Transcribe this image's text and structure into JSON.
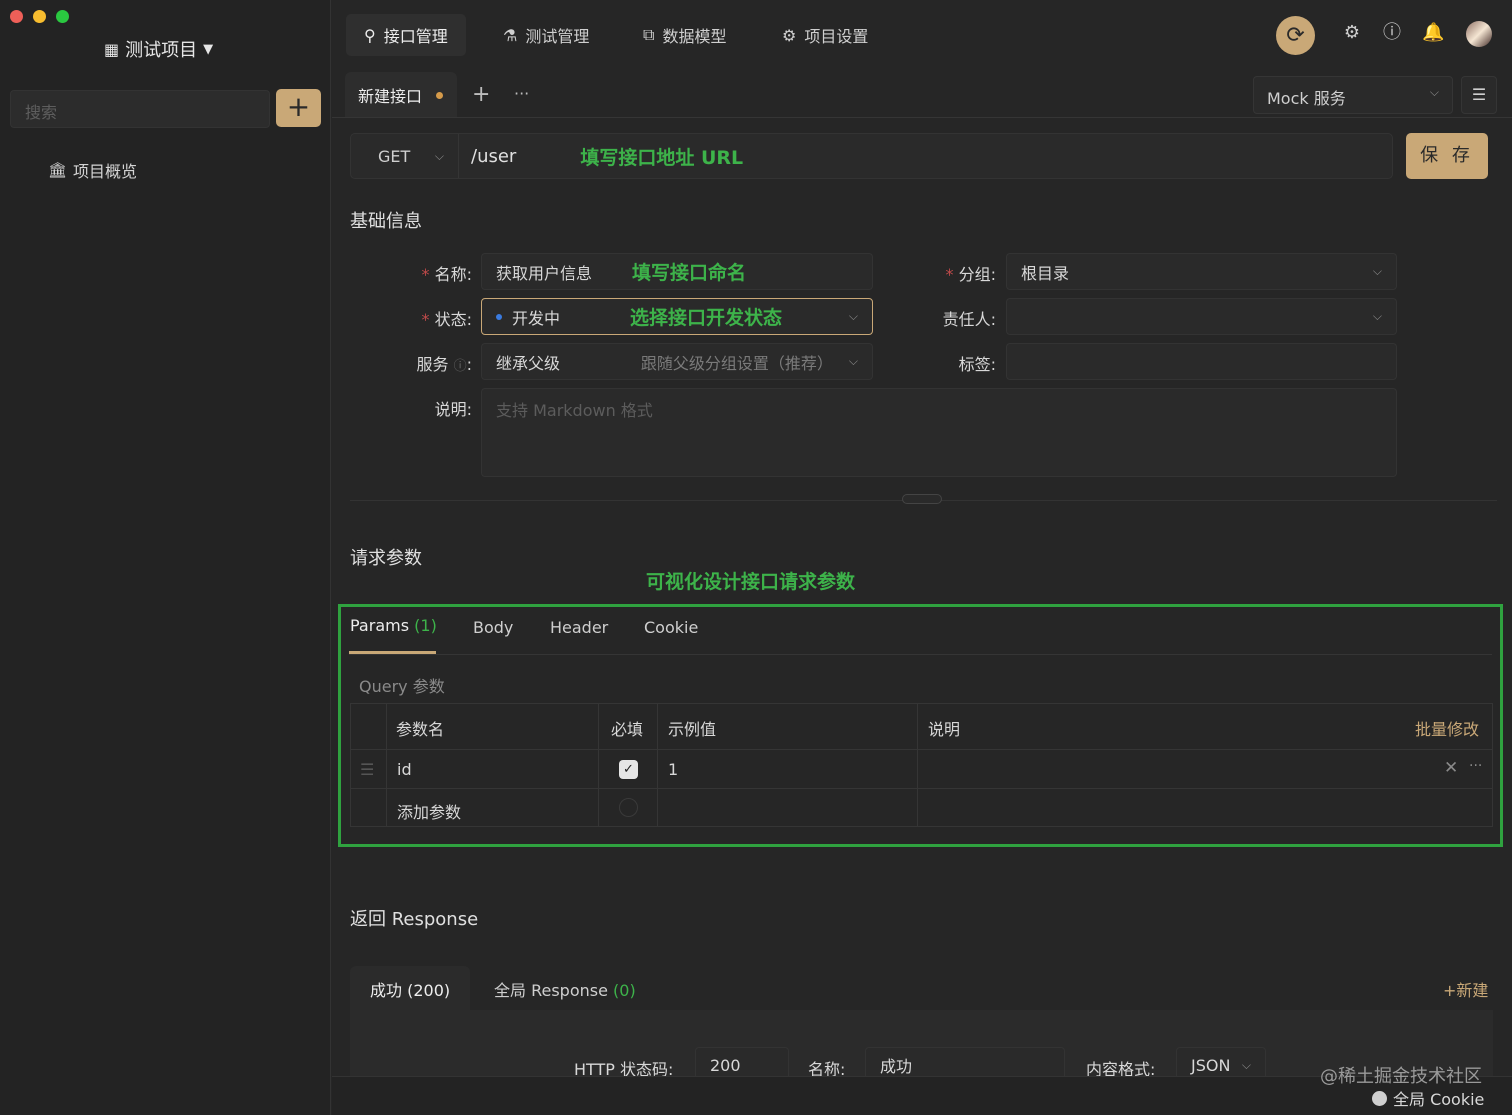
{
  "sidebar": {
    "project_title": "测试项目",
    "search_placeholder": "搜索",
    "add_label": "+",
    "overview_label": "项目概览"
  },
  "topnav": {
    "items": [
      {
        "label": "接口管理",
        "icon": "link-icon"
      },
      {
        "label": "测试管理",
        "icon": "flask-icon"
      },
      {
        "label": "数据模型",
        "icon": "model-icon"
      },
      {
        "label": "项目设置",
        "icon": "gear-icon"
      }
    ]
  },
  "doc_tabs": {
    "active_label": "新建接口",
    "add": "+",
    "more": "···"
  },
  "mock": {
    "label": "Mock 服务"
  },
  "request": {
    "method": "GET",
    "url": "/user",
    "url_hint": "填写接口地址 URL",
    "save_label": "保 存"
  },
  "basic": {
    "title": "基础信息",
    "name_label": "名称:",
    "name_value": "获取用户信息",
    "name_hint": "填写接口命名",
    "status_label": "状态:",
    "status_value": "开发中",
    "status_hint": "选择接口开发状态",
    "service_label": "服务",
    "service_value": "继承父级",
    "service_desc": "跟随父级分组设置（推荐）",
    "desc_label": "说明:",
    "desc_placeholder": "支持 Markdown 格式",
    "group_label": "分组:",
    "group_value": "根目录",
    "owner_label": "责任人:",
    "tags_label": "标签:"
  },
  "params": {
    "title": "请求参数",
    "hint": "可视化设计接口请求参数",
    "tabs": [
      {
        "label": "Params",
        "count": "(1)"
      },
      {
        "label": "Body"
      },
      {
        "label": "Header"
      },
      {
        "label": "Cookie"
      }
    ],
    "query_label": "Query 参数",
    "columns": [
      "参数名",
      "必填",
      "示例值",
      "说明"
    ],
    "bulk_edit": "批量修改",
    "rows": [
      {
        "name": "id",
        "required": true,
        "example": "1"
      }
    ],
    "add_placeholder": "添加参数"
  },
  "response": {
    "title": "返回 Response",
    "tabs": [
      {
        "label": "成功 (200)"
      },
      {
        "label": "全局 Response",
        "count": "(0)"
      }
    ],
    "new_label": "+新建",
    "status_code_label": "HTTP 状态码:",
    "status_code_value": "200",
    "name_label": "名称:",
    "name_value": "成功",
    "format_label": "内容格式:",
    "format_value": "JSON"
  },
  "footer": {
    "global_cookie": "全局 Cookie",
    "watermark": "@稀土掘金技术社区"
  },
  "colors": {
    "accent": "#c9a877",
    "hint_green": "#3db34a",
    "box_green": "#2fa23f",
    "background": "#262626"
  }
}
